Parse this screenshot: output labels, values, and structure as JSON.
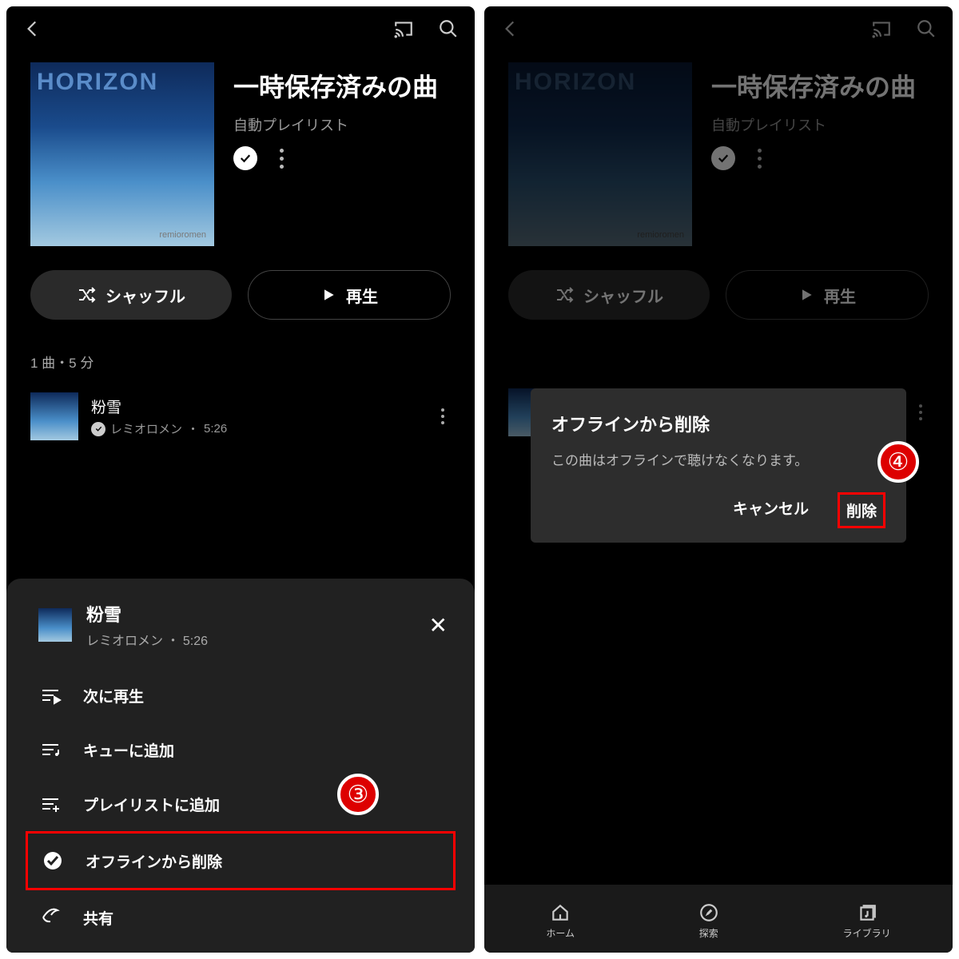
{
  "left": {
    "playlist": {
      "title": "一時保存済みの曲",
      "subtitle": "自動プレイリスト",
      "album_text": "HORIZON",
      "album_artist": "remioromen"
    },
    "buttons": {
      "shuffle": "シャッフル",
      "play": "再生"
    },
    "meta": "1 曲・5 分",
    "track": {
      "title": "粉雪",
      "artist": "レミオロメン",
      "duration": "5:26"
    },
    "sheet": {
      "title": "粉雪",
      "subtitle": "レミオロメン ・ 5:26",
      "items": {
        "play_next": "次に再生",
        "add_queue": "キューに追加",
        "add_playlist": "プレイリストに追加",
        "remove_offline": "オフラインから削除",
        "share": "共有"
      }
    },
    "badge": "③"
  },
  "right": {
    "dialog": {
      "title": "オフラインから削除",
      "body": "この曲はオフラインで聴けなくなります。",
      "cancel": "キャンセル",
      "delete": "削除"
    },
    "badge": "④",
    "nav": {
      "home": "ホーム",
      "explore": "探索",
      "library": "ライブラリ"
    }
  }
}
